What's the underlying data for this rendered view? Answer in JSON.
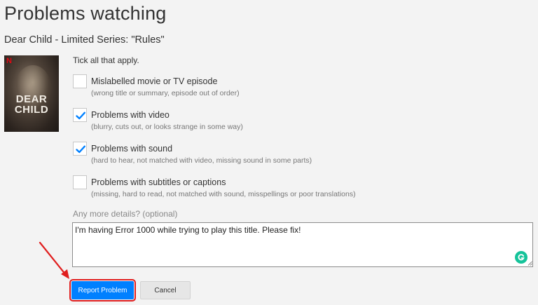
{
  "header": {
    "title": "Problems watching",
    "subtitle": "Dear Child - Limited Series: \"Rules\""
  },
  "poster": {
    "brand": "N",
    "title_line1": "DEAR",
    "title_line2": "CHILD"
  },
  "form": {
    "instructions": "Tick all that apply.",
    "options": [
      {
        "label": "Mislabelled movie or TV episode",
        "description": "(wrong title or summary, episode out of order)",
        "checked": false
      },
      {
        "label": "Problems with video",
        "description": "(blurry, cuts out, or looks strange in some way)",
        "checked": true
      },
      {
        "label": "Problems with sound",
        "description": "(hard to hear, not matched with video, missing sound in some parts)",
        "checked": true
      },
      {
        "label": "Problems with subtitles or captions",
        "description": "(missing, hard to read, not matched with sound, misspellings or poor translations)",
        "checked": false
      }
    ],
    "details_label": "Any more details? (optional)",
    "details_value": "I'm having Error 1000 while trying to play this title. Please fix!"
  },
  "actions": {
    "report_label": "Report Problem",
    "cancel_label": "Cancel"
  },
  "colors": {
    "primary_button": "#0080ff",
    "checkmark": "#0080ff",
    "annotation_red": "#e01e1e",
    "grammarly": "#15c39a"
  },
  "icons": [
    "checkmark-icon",
    "grammarly-icon",
    "resize-grip-icon",
    "annotation-arrow-icon"
  ]
}
